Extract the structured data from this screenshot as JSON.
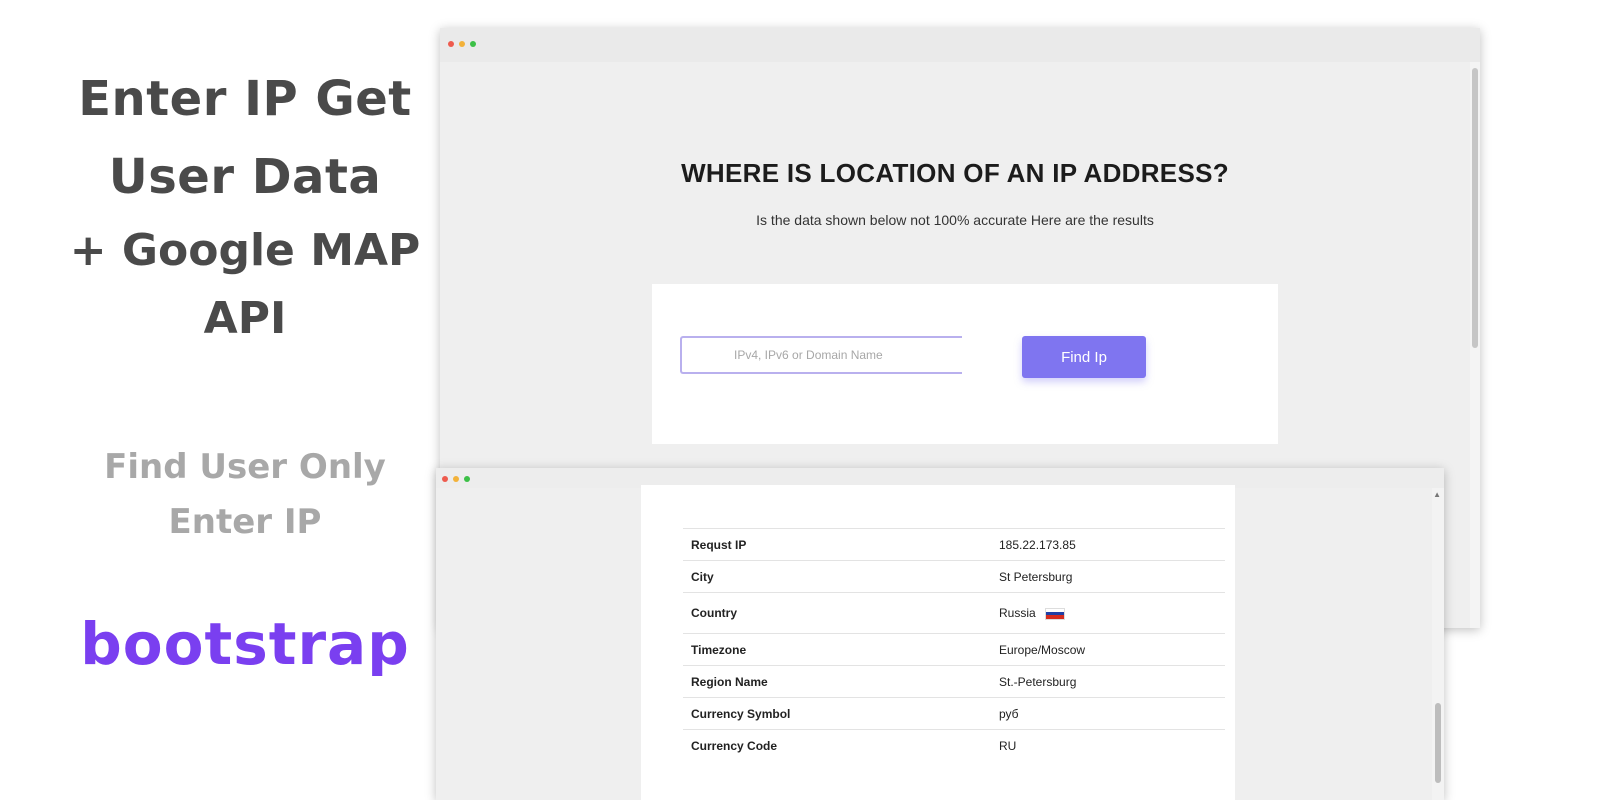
{
  "promo": {
    "line1": "Enter IP Get",
    "line2": "User Data",
    "line3": "+ Google MAP",
    "line4": "API",
    "line5": "Find User Only",
    "line6": "Enter IP",
    "brand": "bootstrap"
  },
  "window1": {
    "title": "WHERE IS LOCATION OF AN IP ADDRESS?",
    "subtitle": "Is the data shown below not 100% accurate Here are the results",
    "search": {
      "placeholder": "IPv4, IPv6 or Domain Name",
      "value": "",
      "button_label": "Find Ip"
    }
  },
  "window2": {
    "rows": [
      {
        "key": "Requst IP",
        "value": "185.22.173.85"
      },
      {
        "key": "City",
        "value": "St Petersburg"
      },
      {
        "key": "Country",
        "value": "Russia"
      },
      {
        "key": "Timezone",
        "value": "Europe/Moscow"
      },
      {
        "key": "Region Name",
        "value": "St.-Petersburg"
      },
      {
        "key": "Currency Symbol",
        "value": "руб"
      },
      {
        "key": "Currency Code",
        "value": "RU"
      }
    ],
    "flag_colors": [
      "#ffffff",
      "#1f3fa6",
      "#d52b1e"
    ]
  },
  "colors": {
    "accent": "#7f75f0",
    "brand": "#7a3ff0"
  }
}
